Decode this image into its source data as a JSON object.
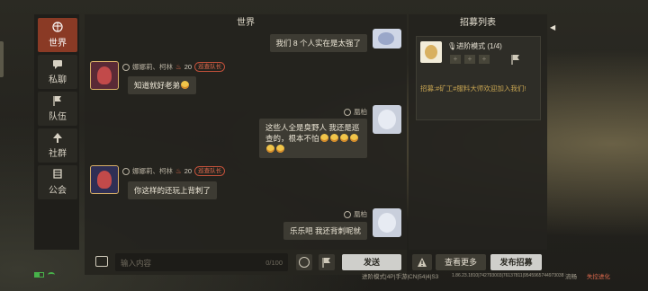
{
  "nav": {
    "items": [
      {
        "label": "世界",
        "icon": "globe-icon",
        "active": true
      },
      {
        "label": "私聊",
        "icon": "chat-bubble-icon"
      },
      {
        "label": "队伍",
        "icon": "flag-icon"
      },
      {
        "label": "社群",
        "icon": "tree-icon"
      },
      {
        "label": "公会",
        "icon": "banner-icon"
      }
    ]
  },
  "chat": {
    "title": "世界",
    "messages": [
      {
        "text": "我们 8 个人实在是太强了"
      },
      {
        "sender": "娜娜莉、柯林",
        "level": "20",
        "tag": "巡查队长",
        "text": "知道就好老弟"
      },
      {
        "sender": "凰柏",
        "text": "这些人全是臭野人 我还是巡查的，根本不怕"
      },
      {
        "sender": "娜娜莉、柯林",
        "level": "20",
        "tag": "巡查队长",
        "text": "你这样的还玩上背刺了"
      },
      {
        "sender": "凰柏",
        "text": "乐乐吧 我还背刺呢就"
      }
    ],
    "input_placeholder": "输入内容",
    "char_count": "0/100",
    "send_label": "发送"
  },
  "recruit": {
    "title": "招募列表",
    "mode": "进阶模式 (1/4)",
    "slot_plus": "+",
    "message": "招募:#矿工#服料大师欢迎加入我们!",
    "more_label": "查看更多",
    "publish_label": "发布招募",
    "collapse_arrow": "◀"
  },
  "status": {
    "mode_text": "进阶模式|4P|手游|CN|54|4|S3",
    "version": "1.86.23.1810|742793003|76137811|9545965744973038",
    "data_label": "流畅",
    "brand": "失控进化"
  }
}
